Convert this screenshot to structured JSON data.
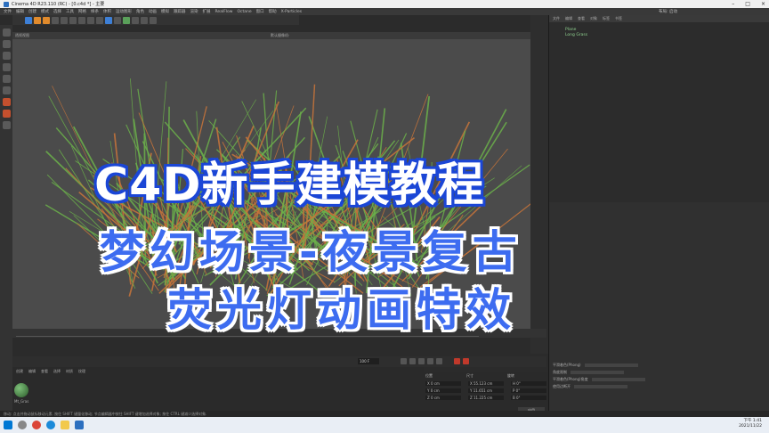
{
  "window": {
    "title": "Cinema 4D R23.110 (RC) - [0.c4d *] - 主要"
  },
  "menu": {
    "items": [
      "文件",
      "编辑",
      "创建",
      "模式",
      "选择",
      "工具",
      "网格",
      "样条",
      "体积",
      "运动图形",
      "角色",
      "动画",
      "模拟",
      "跟踪器",
      "渲染",
      "扩展",
      "RealFlow",
      "Octane",
      "窗口",
      "帮助",
      "X-Particles"
    ],
    "layout": "布局: 启动"
  },
  "viewport": {
    "view_label": "透视视图",
    "camera_label": "默认摄像机·"
  },
  "object_manager": {
    "tabs": [
      "文件",
      "编辑",
      "查看",
      "对象",
      "标签",
      "书签"
    ],
    "items": [
      "Plane",
      "Long Grass"
    ]
  },
  "timeline": {
    "frame_value": "100 F"
  },
  "material": {
    "tabs": [
      "创建",
      "编辑",
      "查看",
      "选择",
      "材质",
      "纹理"
    ],
    "name": "Mt_Gras"
  },
  "coords": {
    "headers": [
      "位置",
      "尺寸",
      "旋转"
    ],
    "rows": [
      [
        "X 0 cm",
        "X 55.123 cm",
        "H 0°"
      ],
      [
        "Y 0 cm",
        "Y 11.651 cm",
        "P 0°"
      ],
      [
        "Z 0 cm",
        "Z 11.225 cm",
        "B 0°"
      ]
    ],
    "apply": "应用"
  },
  "attributes": {
    "rows": [
      "平滑着色(Phong)",
      "角度限制",
      "平滑着色(Phong)角度",
      "使用边断开"
    ]
  },
  "status": {
    "text": "移动: 点击并拖动鼠标移动元素. 按住 SHIFT 键量化移动; 节点编辑器中按住 SHIFT 键增加选择对象; 按住 CTRL 键减少选择对象."
  },
  "clock": {
    "time": "下午 1:41",
    "date": "2021/11/22"
  },
  "overlay": {
    "line1": "C4D新手建模教程",
    "line2": "梦幻场景-夜景复古",
    "line3": "荧光灯动画特效"
  },
  "colors": {
    "accent_blue": "#3d6cf0",
    "outline_blue": "#1b46d6",
    "grass_green": "#6bb04a",
    "grass_orange": "#c8743a"
  },
  "icons": [
    "cinema4d-app-icon",
    "move-tool-icon",
    "scale-tool-icon",
    "rotate-tool-icon",
    "render-icon",
    "windows-start-icon",
    "search-icon",
    "chrome-icon",
    "edge-icon",
    "explorer-icon"
  ]
}
